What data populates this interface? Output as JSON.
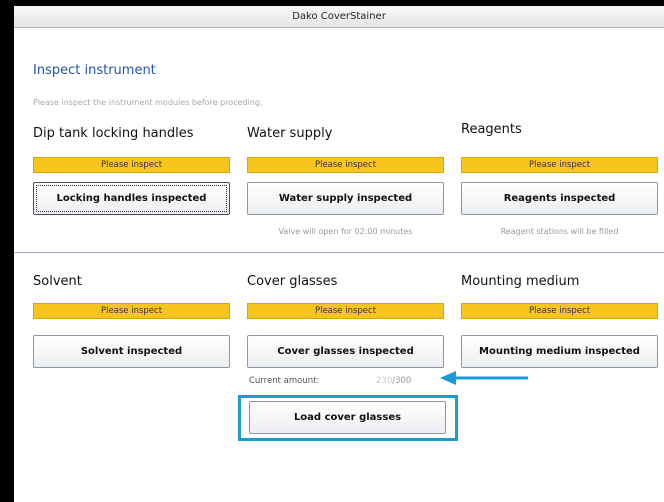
{
  "window": {
    "title": "Dako CoverStainer"
  },
  "page": {
    "title": "Inspect instrument",
    "subtitle": "Please inspect the instrument modules before proceding."
  },
  "sections": [
    {
      "id": "dip-tank",
      "heading": "Dip tank locking handles",
      "status": "Please inspect",
      "button": "Locking handles inspected",
      "note": ""
    },
    {
      "id": "water-supply",
      "heading": "Water supply",
      "status": "Please inspect",
      "button": "Water supply inspected",
      "note": "Valve will open for 02:00 minutes"
    },
    {
      "id": "reagents",
      "heading": "Reagents",
      "status": "Please inspect",
      "button": "Reagents inspected",
      "note": "Reagent stations will be filled"
    },
    {
      "id": "solvent",
      "heading": "Solvent",
      "status": "Please inspect",
      "button": "Solvent inspected",
      "note": ""
    },
    {
      "id": "cover-glasses",
      "heading": "Cover glasses",
      "status": "Please inspect",
      "button": "Cover glasses inspected",
      "note": ""
    },
    {
      "id": "mounting-medium",
      "heading": "Mounting medium",
      "status": "Please inspect",
      "button": "Mounting medium inspected",
      "note": ""
    }
  ],
  "cover_glasses": {
    "current_amount_label": "Current amount:",
    "current_value": "230",
    "separator": "/",
    "max_value": "300",
    "load_button": "Load cover glasses"
  },
  "colors": {
    "status_badge": "#f7c51e",
    "title": "#2454a8",
    "annotation": "#1a9ad6"
  },
  "annotations": {
    "arrow_icon": "left-arrow-icon",
    "highlight": "highlight-box"
  }
}
